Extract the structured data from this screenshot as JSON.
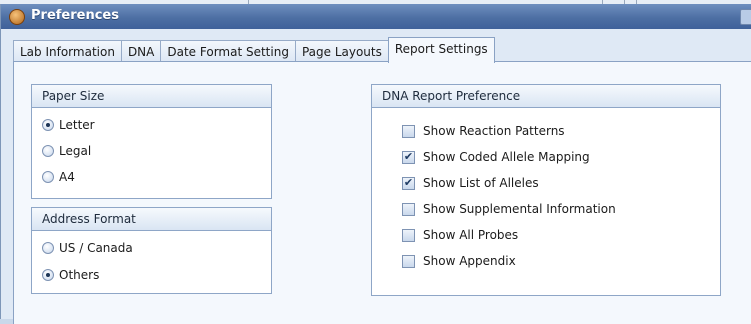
{
  "window": {
    "title": "Preferences"
  },
  "tabs": [
    "Lab Information",
    "DNA",
    "Date Format Setting",
    "Page Layouts",
    "Report Settings"
  ],
  "active_tab": "Report Settings",
  "paper_size": {
    "header": "Paper Size",
    "options": [
      "Letter",
      "Legal",
      "A4"
    ],
    "selected": "Letter"
  },
  "address_format": {
    "header": "Address Format",
    "options": [
      "US / Canada",
      "Others"
    ],
    "selected": "Others"
  },
  "dna_report": {
    "header": "DNA Report Preference",
    "options": [
      {
        "label": "Show Reaction Patterns",
        "checked": false
      },
      {
        "label": "Show Coded Allele Mapping",
        "checked": true
      },
      {
        "label": "Show List of Alleles",
        "checked": true
      },
      {
        "label": "Show Supplemental Information",
        "checked": false
      },
      {
        "label": "Show All Probes",
        "checked": false
      },
      {
        "label": "Show Appendix",
        "checked": false
      }
    ]
  },
  "colors": {
    "titlebar": "#4d6fa3",
    "panel": "#dfe9f5"
  }
}
